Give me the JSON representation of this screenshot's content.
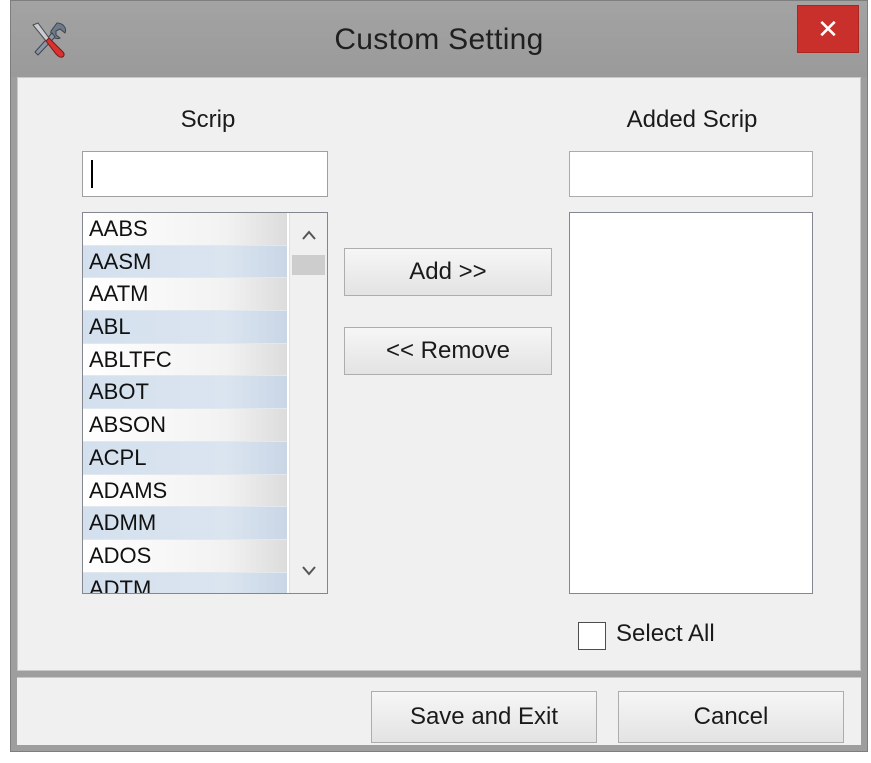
{
  "window": {
    "title": "Custom Setting",
    "app_icon": "tools-icon",
    "close_symbol": "✕"
  },
  "left_panel": {
    "label": "Scrip",
    "search_value": "",
    "items": [
      "AABS",
      "AASM",
      "AATM",
      "ABL",
      "ABLTFC",
      "ABOT",
      "ABSON",
      "ACPL",
      "ADAMS",
      "ADMM",
      "ADOS",
      "ADTM"
    ]
  },
  "right_panel": {
    "label": "Added Scrip",
    "search_value": "",
    "items": [],
    "select_all_label": "Select All",
    "select_all_checked": false
  },
  "actions": {
    "add_label": "Add >>",
    "remove_label": "<< Remove"
  },
  "footer": {
    "save_label": "Save and Exit",
    "cancel_label": "Cancel"
  },
  "colors": {
    "close_button": "#c9302c",
    "titlebar": "#9e9e9e",
    "client": "#f0f0f0",
    "alt_row": "#d4e0ee"
  }
}
